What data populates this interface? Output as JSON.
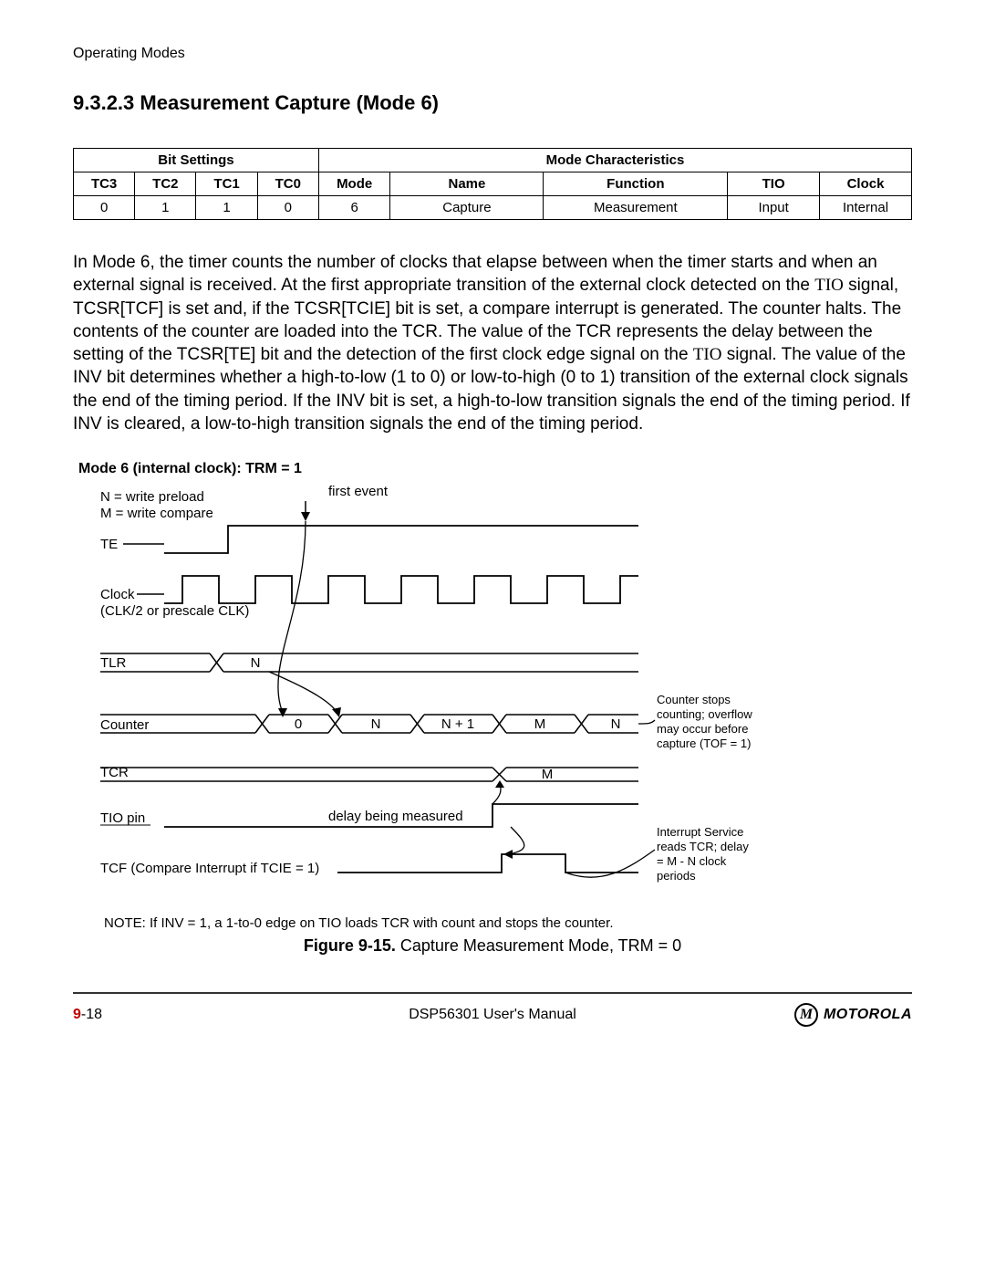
{
  "running_head": "Operating Modes",
  "heading": "9.3.2.3 Measurement Capture (Mode 6)",
  "table": {
    "group_left": "Bit Settings",
    "group_right": "Mode Characteristics",
    "headers": [
      "TC3",
      "TC2",
      "TC1",
      "TC0",
      "Mode",
      "Name",
      "Function",
      "TIO",
      "Clock"
    ],
    "row": [
      "0",
      "1",
      "1",
      "0",
      "6",
      "Capture",
      "Measurement",
      "Input",
      "Internal"
    ]
  },
  "paragraph": {
    "p1": "In Mode 6, the timer counts the number of clocks that elapse between when the timer starts and when an external signal is received. At the first appropriate transition of the external clock detected on the ",
    "tio1": "TIO",
    "p2": " signal, TCSR[TCF] is set and, if the TCSR[TCIE] bit is set, a compare interrupt is generated. The counter halts. The contents of the counter are loaded into the TCR. The value of the TCR represents the delay between the setting of the TCSR[TE] bit and the detection of the first clock edge signal on the ",
    "tio2": "TIO",
    "p3": " signal. The value of the INV bit determines whether a high-to-low (1 to 0) or low-to-high (0 to 1) transition of the external clock signals the end of the timing period. If the INV bit is set, a high-to-low transition signals the end of the timing period. If INV is cleared, a low-to-high transition signals the end of the timing period."
  },
  "diagram": {
    "title": "Mode 6 (internal clock): TRM = 1",
    "legend_n": "N = write preload",
    "legend_m": "M = write compare",
    "first_event": "first event",
    "rows": {
      "te": "TE",
      "clock": "Clock",
      "clock_sub": "(CLK/2 or prescale CLK)",
      "tlr": "TLR",
      "counter": "Counter",
      "tcr": "TCR",
      "tio": "TIO pin",
      "tcf": "TCF (Compare Interrupt if TCIE = 1)",
      "delay_label": "delay being measured"
    },
    "tlr_value": "N",
    "counter_values": [
      "0",
      "N",
      "N + 1",
      "M",
      "N"
    ],
    "tcr_value": "M",
    "side_note_counter_1": "Counter stops",
    "side_note_counter_2": "counting; overflow",
    "side_note_counter_3": "may occur before",
    "side_note_counter_4": "capture (TOF = 1)",
    "side_note_isr_1": "Interrupt Service",
    "side_note_isr_2": "reads TCR; delay",
    "side_note_isr_3": "= M - N clock",
    "side_note_isr_4": "periods"
  },
  "note": "NOTE: If INV = 1, a 1-to-0 edge on TIO loads TCR with count and stops the counter.",
  "figure_label": "Figure 9-15.",
  "figure_caption": " Capture Measurement Mode, TRM = 0",
  "footer": {
    "chapter": "9",
    "page": "-18",
    "manual": "DSP56301 User's Manual",
    "brand": "MOTOROLA",
    "logo_glyph": "M"
  },
  "chart_data": {
    "type": "table",
    "title": "Mode 6 Bit Settings and Characteristics",
    "columns": [
      "TC3",
      "TC2",
      "TC1",
      "TC0",
      "Mode",
      "Name",
      "Function",
      "TIO",
      "Clock"
    ],
    "rows": [
      [
        "0",
        "1",
        "1",
        "0",
        "6",
        "Capture",
        "Measurement",
        "Input",
        "Internal"
      ]
    ]
  }
}
